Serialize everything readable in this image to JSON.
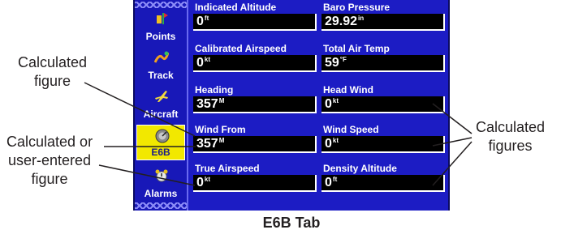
{
  "tabs": [
    {
      "label": "Points",
      "icon": "points-icon",
      "active": false
    },
    {
      "label": "Track",
      "icon": "track-icon",
      "active": false
    },
    {
      "label": "Aircraft",
      "icon": "aircraft-icon",
      "active": false
    },
    {
      "label": "E6B",
      "icon": "e6b-icon",
      "active": true
    },
    {
      "label": "Alarms",
      "icon": "alarms-icon",
      "active": false
    }
  ],
  "fields": [
    {
      "label": "Indicated Altitude",
      "value": "0",
      "unit": "ft"
    },
    {
      "label": "Baro Pressure",
      "value": "29.92",
      "unit": "in"
    },
    {
      "label": "Calibrated Airspeed",
      "value": "0",
      "unit": "kt"
    },
    {
      "label": "Total Air Temp",
      "value": "59",
      "unit": "°F"
    },
    {
      "label": "Heading",
      "value": "357",
      "unit": "M"
    },
    {
      "label": "Head Wind",
      "value": "0",
      "unit": "kt"
    },
    {
      "label": "Wind From",
      "value": "357",
      "unit": "M"
    },
    {
      "label": "Wind Speed",
      "value": "0",
      "unit": "kt"
    },
    {
      "label": "True Airspeed",
      "value": "0",
      "unit": "kt"
    },
    {
      "label": "Density Altitude",
      "value": "0",
      "unit": "ft"
    }
  ],
  "annotations": {
    "calculated_figure": [
      "Calculated",
      "figure"
    ],
    "user_entered": [
      "Calculated or",
      "user-entered",
      "figure"
    ],
    "calculated_figures": [
      "Calculated",
      "figures"
    ]
  },
  "caption": "E6B Tab",
  "colors": {
    "screen_bg": "#1c1cc4",
    "active_tab": "#f2e800",
    "field_bg": "#000000",
    "text": "#ffffff"
  }
}
